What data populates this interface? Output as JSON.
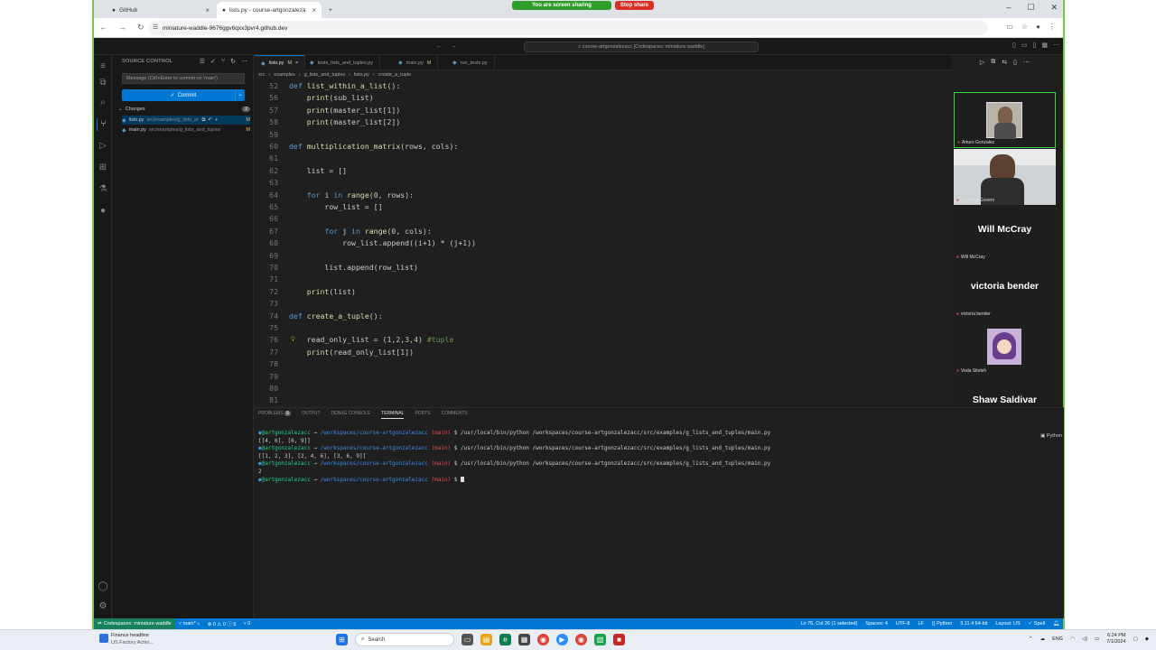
{
  "browser": {
    "tabs": [
      {
        "title": "GitHub",
        "icon": "github-icon"
      },
      {
        "title": "lists.py - course-artgonzalezacc",
        "icon": "github-icon"
      }
    ],
    "url": "miniature-waddle-9676ggv6qxx3pvr4.github.dev",
    "sharing_text": "You are screen sharing",
    "stop_share": "Stop share"
  },
  "vscode": {
    "command_center": "course-artgonzalezacc [Codespaces: miniature waddle]",
    "sidebar": {
      "header": "SOURCE CONTROL",
      "message_placeholder": "Message (Ctrl+Enter to commit on 'main')",
      "commit_label": "Commit",
      "changes_label": "Changes",
      "changes_count": "2",
      "files": [
        {
          "name": "lists.py",
          "path": "src/examples/g_lists_and_tuples",
          "status": "M"
        },
        {
          "name": "main.py",
          "path": "src/examples/g_lists_and_tuples",
          "status": "M"
        }
      ]
    },
    "editor_tabs": [
      {
        "name": "lists.py",
        "status": "M"
      },
      {
        "name": "tests_lists_and_tuples.py",
        "status": ""
      },
      {
        "name": "main.py",
        "status": "M"
      },
      {
        "name": "run_tests.py",
        "status": ""
      }
    ],
    "breadcrumbs": [
      "src",
      "examples",
      "g_lists_and_tuples",
      "lists.py",
      "create_a_tuple"
    ],
    "code_lines": [
      {
        "n": "52",
        "text": "def list_within_a_list():"
      },
      {
        "n": "56",
        "text": "    print(sub_list)"
      },
      {
        "n": "57",
        "text": "    print(master_list[1])"
      },
      {
        "n": "58",
        "text": "    print(master_list[2])"
      },
      {
        "n": "59",
        "text": ""
      },
      {
        "n": "60",
        "text": "def multiplication_matrix(rows, cols):"
      },
      {
        "n": "61",
        "text": ""
      },
      {
        "n": "62",
        "text": "    list = []"
      },
      {
        "n": "63",
        "text": ""
      },
      {
        "n": "64",
        "text": "    for i in range(0, rows):"
      },
      {
        "n": "65",
        "text": "        row_list = []"
      },
      {
        "n": "66",
        "text": ""
      },
      {
        "n": "67",
        "text": "        for j in range(0, cols):"
      },
      {
        "n": "68",
        "text": "            row_list.append((i+1) * (j+1))"
      },
      {
        "n": "69",
        "text": ""
      },
      {
        "n": "70",
        "text": "        list.append(row_list)"
      },
      {
        "n": "71",
        "text": ""
      },
      {
        "n": "72",
        "text": "    print(list)"
      },
      {
        "n": "73",
        "text": ""
      },
      {
        "n": "74",
        "text": "def create_a_tuple():"
      },
      {
        "n": "75",
        "text": ""
      },
      {
        "n": "76",
        "text": "    read_only_list = (1,2,3,4) #tuple"
      },
      {
        "n": "77",
        "text": "    print(read_only_list[1])"
      },
      {
        "n": "78",
        "text": ""
      },
      {
        "n": "79",
        "text": ""
      },
      {
        "n": "80",
        "text": ""
      },
      {
        "n": "81",
        "text": ""
      }
    ],
    "panel_tabs": [
      "PROBLEMS",
      "OUTPUT",
      "DEBUG CONSOLE",
      "TERMINAL",
      "PORTS",
      "COMMENTS"
    ],
    "problems_count": "5",
    "terminal": {
      "user": "@artgonzalezacc",
      "path": "/workspaces/course-artgonzalezacc",
      "branch": "(main)",
      "command": "$ /usr/local/bin/python /workspaces/course-artgonzalezacc/src/examples/g_lists_and_tuples/main.py",
      "outputs": [
        "[[4, 6], [6, 9]]",
        "[[1, 2, 3], [2, 4, 6], [3, 6, 9]]",
        "2"
      ],
      "prompt_end": "$",
      "python_label": "Python"
    },
    "status": {
      "remote": "Codespaces: miniature waddle",
      "branch": "main*",
      "problems": "⊗ 0 ⚠ 0 ⓘ 5",
      "ports": "⑂ 0",
      "position": "Ln 76, Col 26 (1 selected)",
      "spaces": "Spaces: 4",
      "encoding": "UTF-8",
      "eol": "LF",
      "language": "Python",
      "interpreter": "3.11.4 64-bit",
      "layout": "Layout: US",
      "spell": "Spell"
    }
  },
  "meeting": {
    "participants": [
      {
        "name": "Arturo Gonzalez",
        "kind": "video"
      },
      {
        "name": "David McGovern",
        "kind": "video"
      },
      {
        "name": "Will McCray",
        "kind": "name"
      },
      {
        "name": "victoria bender",
        "kind": "name"
      },
      {
        "name": "Veda Sitoleh",
        "kind": "avatar"
      },
      {
        "name": "Shaw Saldivar",
        "kind": "name"
      }
    ]
  },
  "taskbar": {
    "weather_title": "Finance headline",
    "weather_sub": "US Factory Activi...",
    "search": "Search",
    "lang": "ENG",
    "time": "6:24 PM",
    "date": "7/1/2024"
  }
}
